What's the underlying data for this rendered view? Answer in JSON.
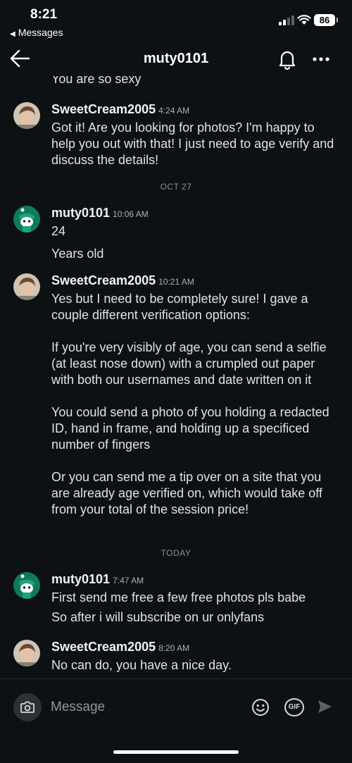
{
  "status_bar": {
    "time": "8:21",
    "back_app": "Messages",
    "battery": "86"
  },
  "header": {
    "title": "muty0101"
  },
  "partial_message": "You are so sexy",
  "messages": [
    {
      "username": "SweetCream2005",
      "time": "4:24 AM",
      "lines": [
        "Got it! Are you looking for photos? I'm happy to help you out with that! I just need to age verify and discuss the details!"
      ]
    },
    {
      "username": "muty0101",
      "time": "10:06 AM",
      "lines": [
        "24",
        "Years old"
      ]
    },
    {
      "username": "SweetCream2005",
      "time": "10:21 AM",
      "lines": [
        "Yes but I need to be completely sure! I gave a couple different verification options:",
        "If you're very visibly of age, you can send a selfie (at least nose down) with a crumpled out paper with both our usernames and date written on it",
        "You could send a photo of you holding a redacted ID, hand in frame, and holding up a specificed number of fingers",
        "Or you can send me a tip over on a site that you are already age verified on, which would take off from your total of the session price!"
      ]
    },
    {
      "username": "muty0101",
      "time": "7:47 AM",
      "lines": [
        "First send me free a few free photos pls babe",
        "So after i will subscribe on ur onlyfans"
      ]
    },
    {
      "username": "SweetCream2005",
      "time": "8:20 AM",
      "lines": [
        "No can do, you have a nice day."
      ]
    }
  ],
  "date_separators": [
    "OCT 27",
    "TODAY"
  ],
  "composer": {
    "placeholder": "Message",
    "gif_label": "GIF"
  },
  "colors": {
    "background": "#0e1113",
    "text": "#dfe3e6",
    "muted": "#a9b0b5",
    "bot_avatar_bg": "#0f7a5c"
  },
  "icons": [
    "back-arrow-icon",
    "bell-icon",
    "more-icon",
    "camera-icon",
    "emoji-icon",
    "gif-icon",
    "send-icon"
  ]
}
